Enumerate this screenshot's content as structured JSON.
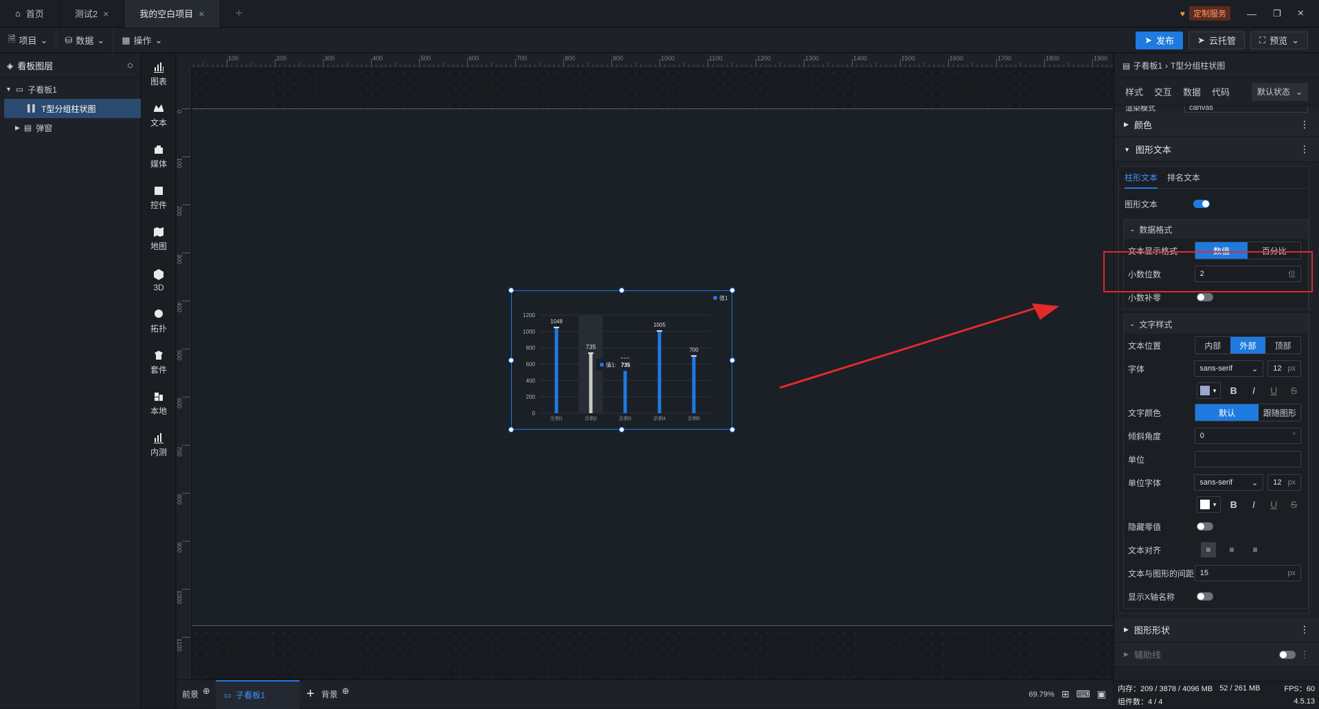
{
  "tabs": [
    {
      "label": "首页"
    },
    {
      "label": "测试2"
    },
    {
      "label": "我的空白项目"
    }
  ],
  "header": {
    "service_label": "定制服务"
  },
  "toolbar": {
    "project": "项目",
    "data": "数据",
    "operate": "操作",
    "publish": "发布",
    "cloud": "云托管",
    "preview": "预览"
  },
  "layers": {
    "title": "看板图层",
    "items": [
      {
        "label": "子看板1"
      },
      {
        "label": "T型分组柱状图"
      },
      {
        "label": "弹窗"
      }
    ]
  },
  "components": [
    {
      "label": "图表",
      "icon": "chart-icon"
    },
    {
      "label": "文本",
      "icon": "text-icon"
    },
    {
      "label": "媒体",
      "icon": "media-icon"
    },
    {
      "label": "控件",
      "icon": "control-icon"
    },
    {
      "label": "地图",
      "icon": "map-icon"
    },
    {
      "label": "3D",
      "icon": "cube-icon"
    },
    {
      "label": "拓扑",
      "icon": "topology-icon"
    },
    {
      "label": "套件",
      "icon": "kit-icon"
    },
    {
      "label": "本地",
      "icon": "local-icon"
    },
    {
      "label": "内测",
      "icon": "beta-icon"
    }
  ],
  "ruler": {
    "h": [
      "0",
      "100",
      "200",
      "300",
      "400",
      "500",
      "600",
      "700",
      "800",
      "900",
      "1000",
      "1100",
      "1200",
      "1300",
      "1400",
      "1500",
      "1600",
      "1700",
      "1800",
      "1900"
    ],
    "v": [
      "0",
      "100",
      "200",
      "300",
      "400",
      "500",
      "600",
      "700",
      "800",
      "900",
      "1000",
      "1100"
    ]
  },
  "chart_data": {
    "type": "bar",
    "categories": [
      "示例1",
      "示例2",
      "示例3",
      "示例4",
      "示例5"
    ],
    "values": [
      1048,
      735,
      580,
      1005,
      700
    ],
    "series": [
      {
        "name": "值1",
        "values": [
          1048,
          735,
          580,
          1005,
          700
        ]
      }
    ],
    "yticks": [
      "0",
      "200",
      "400",
      "600",
      "800",
      "1000",
      "1200"
    ],
    "ylim": [
      0,
      1200
    ],
    "legend_position": "top-right",
    "tooltip": {
      "label": "值1:",
      "value": "735"
    },
    "highlight_index": 1,
    "colors": {
      "bar": "#1f7ae0",
      "highlight": "#c9c9c0"
    }
  },
  "bottom": {
    "front": "前景",
    "board": "子看板1",
    "back": "背景",
    "zoom": "69.79%"
  },
  "panel": {
    "breadcrumb_root": "子看板1",
    "breadcrumb_leaf": "T型分组柱状图",
    "tabs": [
      "样式",
      "交互",
      "数据",
      "代码"
    ],
    "state": "默认状态",
    "partial_label": "渲染模式",
    "partial_value": "canvas",
    "sec_color": "颜色",
    "sec_text": "图形文本",
    "subtabs": [
      "柱形文本",
      "排名文本"
    ],
    "graph_text": "图形文本",
    "data_format": "数据格式",
    "display_format": "文本显示格式",
    "fmt_opts": [
      "数值",
      "百分比"
    ],
    "decimals": "小数位数",
    "decimals_value": "2",
    "decimals_unit": "位",
    "zero_pad": "小数补零",
    "text_style": "文字样式",
    "text_pos": "文本位置",
    "pos_opts": [
      "内部",
      "外部",
      "顶部"
    ],
    "font": "字体",
    "font_value": "sans-serif",
    "font_size": "12",
    "px": "px",
    "text_color": "文字颜色",
    "color_opts": [
      "默认",
      "跟随图形"
    ],
    "tilt": "倾斜角度",
    "tilt_value": "0",
    "deg": "°",
    "unit": "单位",
    "unit_font": "单位字体",
    "unit_font_value": "sans-serif",
    "unit_font_size": "12",
    "hide_zero": "隐藏零值",
    "text_align": "文本对齐",
    "gap": "文本与图形的间距",
    "gap_value": "15",
    "show_x": "显示X轴名称",
    "sec_shape": "图形形状",
    "sec_aux": "辅助线"
  },
  "status": {
    "memory": "内存：209 / 3878 / 4096 MB",
    "mem2": "52 / 261 MB",
    "fps": "FPS：60",
    "components": "组件数：4 / 4",
    "version": "4.5.13"
  }
}
